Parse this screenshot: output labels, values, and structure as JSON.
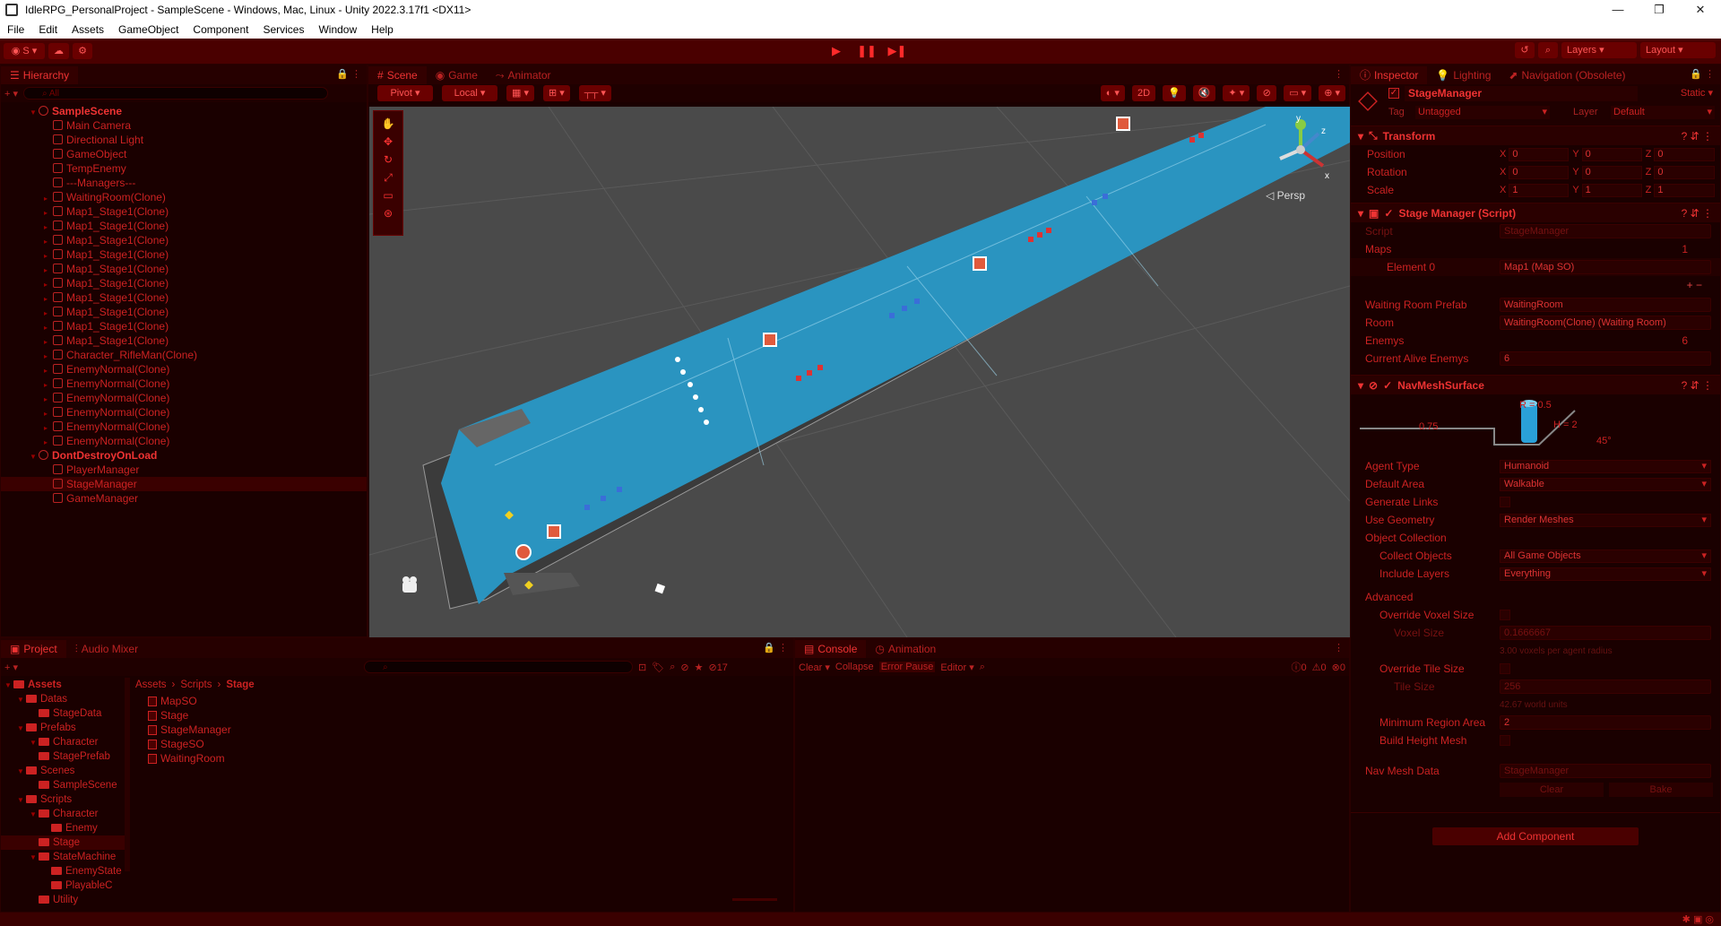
{
  "window": {
    "title": "IdleRPG_PersonalProject - SampleScene - Windows, Mac, Linux - Unity 2022.3.17f1 <DX11>",
    "min": "—",
    "max": "❐",
    "close": "✕"
  },
  "menu": [
    "File",
    "Edit",
    "Assets",
    "GameObject",
    "Component",
    "Services",
    "Window",
    "Help"
  ],
  "toolbar": {
    "account": "S",
    "layers": "Layers",
    "layout": "Layout"
  },
  "hierarchy": {
    "tab": "Hierarchy",
    "scene": "SampleScene",
    "items": [
      "Main Camera",
      "Directional Light",
      "GameObject",
      "TempEnemy",
      "---Managers---",
      "WaitingRoom(Clone)",
      "Map1_Stage1(Clone)",
      "Map1_Stage1(Clone)",
      "Map1_Stage1(Clone)",
      "Map1_Stage1(Clone)",
      "Map1_Stage1(Clone)",
      "Map1_Stage1(Clone)",
      "Map1_Stage1(Clone)",
      "Map1_Stage1(Clone)",
      "Map1_Stage1(Clone)",
      "Map1_Stage1(Clone)",
      "Character_RifleMan(Clone)",
      "EnemyNormal(Clone)",
      "EnemyNormal(Clone)",
      "EnemyNormal(Clone)",
      "EnemyNormal(Clone)",
      "EnemyNormal(Clone)",
      "EnemyNormal(Clone)"
    ],
    "dontdestroy": "DontDestroyOnLoad",
    "dd_items": [
      "PlayerManager",
      "StageManager",
      "GameManager"
    ]
  },
  "scene": {
    "tabs": [
      "Scene",
      "Game",
      "Animator"
    ],
    "pivot": "Pivot",
    "local": "Local",
    "mode2d": "2D",
    "persp": "Persp"
  },
  "inspector": {
    "tabs": [
      "Inspector",
      "Lighting",
      "Navigation (Obsolete)"
    ],
    "object": "StageManager",
    "static": "Static",
    "tag_label": "Tag",
    "tag": "Untagged",
    "layer_label": "Layer",
    "layer": "Default",
    "transform": {
      "title": "Transform",
      "position": "Position",
      "rotation": "Rotation",
      "scale": "Scale",
      "pos": [
        "0",
        "0",
        "0"
      ],
      "rot": [
        "0",
        "0",
        "0"
      ],
      "scl": [
        "1",
        "1",
        "1"
      ]
    },
    "stage_manager": {
      "title": "Stage Manager (Script)",
      "script_label": "Script",
      "script": "StageManager",
      "maps_label": "Maps",
      "maps_count": "1",
      "element_label": "Element 0",
      "element": "Map1 (Map SO)",
      "waiting_label": "Waiting Room Prefab",
      "waiting": "WaitingRoom",
      "room_label": "Room",
      "room": "WaitingRoom(Clone) (Waiting Room)",
      "enemys_label": "Enemys",
      "enemys_count": "6",
      "alive_label": "Current Alive Enemys",
      "alive": "6"
    },
    "navmesh": {
      "title": "NavMeshSurface",
      "r": "R = 0.5",
      "h": "H = 2",
      "w": "0.75",
      "angle": "45°",
      "agent_label": "Agent Type",
      "agent": "Humanoid",
      "area_label": "Default Area",
      "area": "Walkable",
      "links_label": "Generate Links",
      "geom_label": "Use Geometry",
      "geom": "Render Meshes",
      "collection": "Object Collection",
      "collect_label": "Collect Objects",
      "collect": "All Game Objects",
      "include_label": "Include Layers",
      "include": "Everything",
      "advanced": "Advanced",
      "voxel_label": "Override Voxel Size",
      "voxsize_label": "Voxel Size",
      "voxsize": "0.1666667",
      "voxnote": "3.00 voxels per agent radius",
      "tile_label": "Override Tile Size",
      "tilesize_label": "Tile Size",
      "tilesize": "256",
      "tilenote": "42.67 world units",
      "minreg_label": "Minimum Region Area",
      "minreg": "2",
      "height_label": "Build Height Mesh",
      "data_label": "Nav Mesh Data",
      "data": "StageManager",
      "clear": "Clear",
      "bake": "Bake"
    },
    "add_component": "Add Component"
  },
  "project": {
    "tabs": [
      "Project",
      "Audio Mixer"
    ],
    "count": "17",
    "breadcrumb": [
      "Assets",
      "Scripts",
      "Stage"
    ],
    "tree": [
      {
        "n": "Assets",
        "d": 0
      },
      {
        "n": "Datas",
        "d": 1
      },
      {
        "n": "StageData",
        "d": 2
      },
      {
        "n": "Prefabs",
        "d": 1
      },
      {
        "n": "Character",
        "d": 2
      },
      {
        "n": "StagePrefab",
        "d": 2
      },
      {
        "n": "Scenes",
        "d": 1
      },
      {
        "n": "SampleScene",
        "d": 2
      },
      {
        "n": "Scripts",
        "d": 1
      },
      {
        "n": "Character",
        "d": 2
      },
      {
        "n": "Enemy",
        "d": 3
      },
      {
        "n": "Stage",
        "d": 2
      },
      {
        "n": "StateMachine",
        "d": 2
      },
      {
        "n": "EnemyState",
        "d": 3
      },
      {
        "n": "PlayableC",
        "d": 3
      },
      {
        "n": "Utility",
        "d": 2
      }
    ],
    "files": [
      "MapSO",
      "Stage",
      "StageManager",
      "StageSO",
      "WaitingRoom"
    ]
  },
  "console": {
    "tabs": [
      "Console",
      "Animation"
    ],
    "clear": "Clear",
    "collapse": "Collapse",
    "errorpause": "Error Pause",
    "editor": "Editor",
    "c1": "0",
    "c2": "0",
    "c3": "0"
  }
}
